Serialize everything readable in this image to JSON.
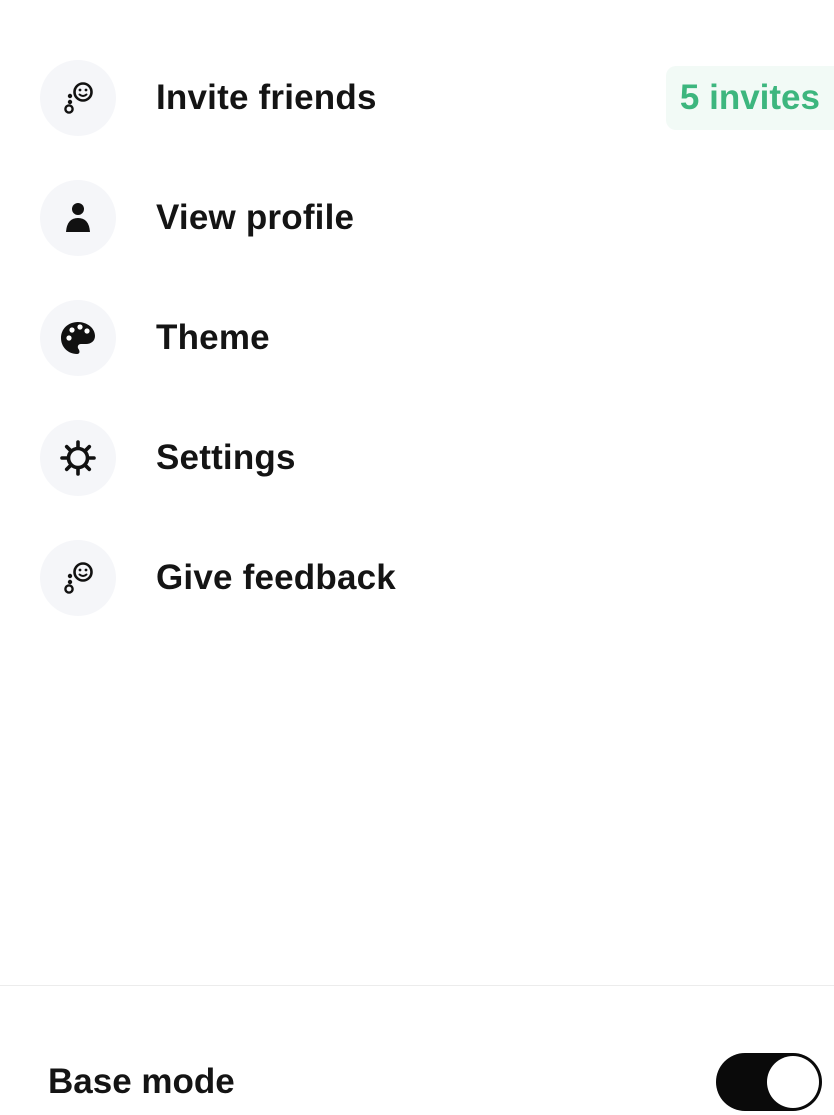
{
  "menu": {
    "items": [
      {
        "label": "Invite friends",
        "icon": "feedback-face-icon",
        "badge": "5 invites"
      },
      {
        "label": "View profile",
        "icon": "person-icon"
      },
      {
        "label": "Theme",
        "icon": "palette-icon"
      },
      {
        "label": "Settings",
        "icon": "gear-icon"
      },
      {
        "label": "Give feedback",
        "icon": "feedback-face-icon"
      }
    ]
  },
  "footer": {
    "base_mode_label": "Base mode",
    "base_mode_on": true
  },
  "colors": {
    "badge_text": "#3db67e",
    "badge_bg": "#f2faf6",
    "icon_circle_bg": "#f5f6f9",
    "toggle_on": "#0a0a0a"
  }
}
